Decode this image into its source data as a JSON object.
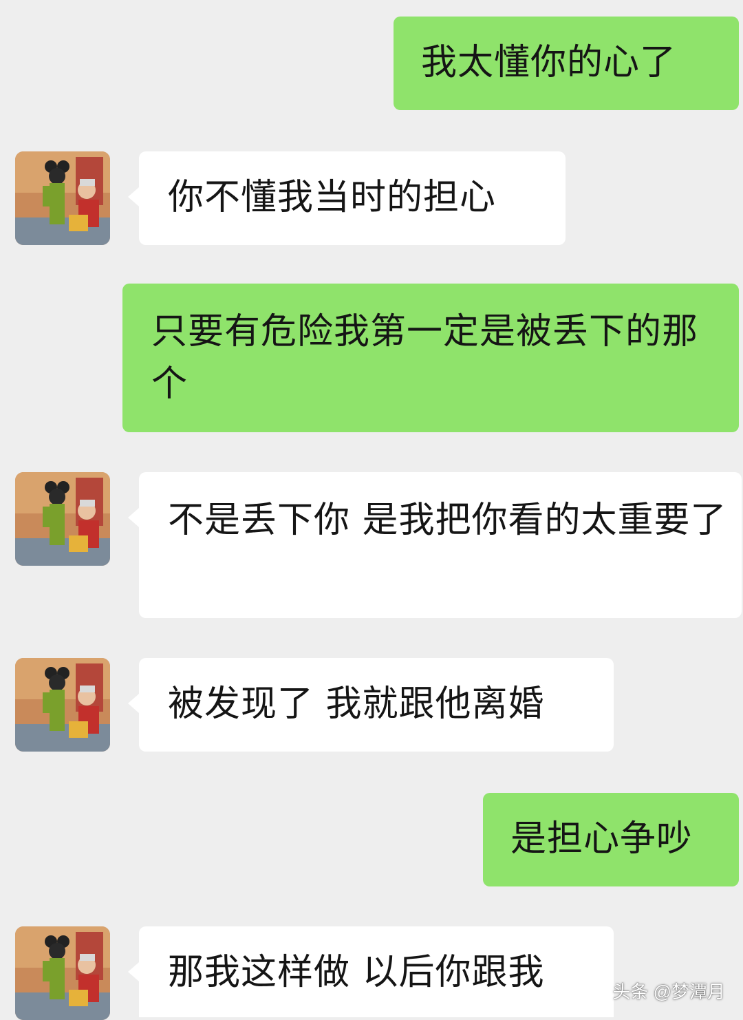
{
  "messages": [
    {
      "side": "out",
      "text": "我太懂你的心了"
    },
    {
      "side": "in",
      "text": "你不懂我当时的担心"
    },
    {
      "side": "out",
      "text": "只要有危险我第一定是被丢下的那个"
    },
    {
      "side": "in",
      "text": "不是丢下你 是我把你看的太重要了"
    },
    {
      "side": "in",
      "text": "被发现了 我就跟他离婚"
    },
    {
      "side": "out",
      "text": "是担心争吵"
    },
    {
      "side": "in",
      "text": "那我这样做 以后你跟我"
    }
  ],
  "watermark": "头条 @梦潭月",
  "colors": {
    "background": "#eeeeee",
    "outgoing_bubble": "#8fe36b",
    "incoming_bubble": "#ffffff"
  }
}
